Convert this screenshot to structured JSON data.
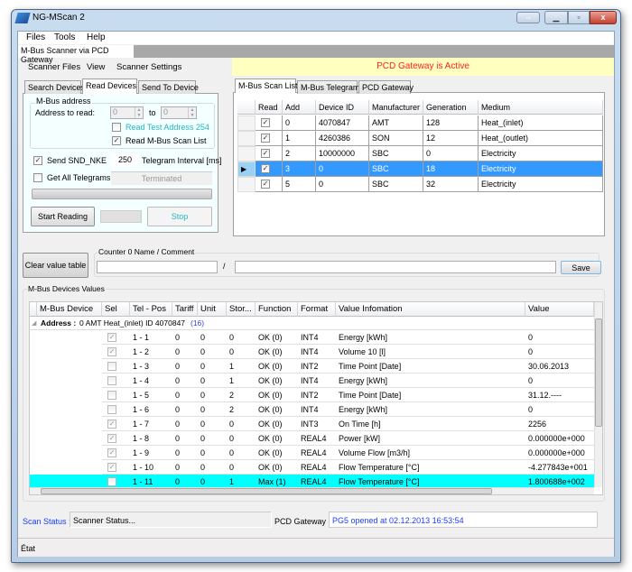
{
  "window": {
    "title": "NG-MScan 2",
    "controls": [
      "swap",
      "minimize",
      "maximize",
      "close"
    ]
  },
  "menu": [
    "Files",
    "Tools",
    "Help"
  ],
  "main_tab": "M-Bus Scanner via PCD Gateway",
  "inner_menu": [
    "Scanner Files",
    "View",
    "Scanner Settings"
  ],
  "banner": {
    "text": "PCD Gateway is Active",
    "color": "#ff2020",
    "bg": "#ffffc0"
  },
  "left_tabs": [
    "Search Devices",
    "Read Devices",
    "Send To Device"
  ],
  "read": {
    "group_title": "M-Bus address",
    "address_label": "Address to read:",
    "from": "0",
    "to_label": "to",
    "to": "0",
    "test_address": {
      "label": "Read Test Address 254",
      "checked": false
    },
    "scan_list": {
      "label": "Read M-Bus Scan List",
      "checked": true
    },
    "snd_nke": {
      "label": "Send SND_NKE",
      "checked": true
    },
    "interval": "250",
    "interval_label": "Telegram Interval [ms]",
    "all_telegrams": {
      "label": "Get All Telegrams",
      "checked": false
    },
    "status": "Terminated",
    "progress": 0,
    "start": "Start Reading",
    "stop": "Stop"
  },
  "right_tabs": [
    "M-Bus Scan List",
    "M-Bus Telegrams",
    "PCD Gateway"
  ],
  "scan_list": {
    "columns": [
      "Read",
      "Add",
      "Device ID",
      "Manufacturer",
      "Generation",
      "Medium"
    ],
    "rows": [
      {
        "read": true,
        "add": "0",
        "id": "4070847",
        "man": "AMT",
        "gen": "128",
        "medium": "Heat_(inlet)"
      },
      {
        "read": true,
        "add": "1",
        "id": "4260386",
        "man": "SON",
        "gen": "12",
        "medium": "Heat_(outlet)"
      },
      {
        "read": true,
        "add": "2",
        "id": "10000000",
        "man": "SBC",
        "gen": "0",
        "medium": "Electricity"
      },
      {
        "read": true,
        "add": "3",
        "id": "0",
        "man": "SBC",
        "gen": "18",
        "medium": "Electricity",
        "selected": true
      },
      {
        "read": true,
        "add": "5",
        "id": "0",
        "man": "SBC",
        "gen": "32",
        "medium": "Electricity"
      }
    ]
  },
  "clear_button": "Clear value table",
  "counter": {
    "title": "Counter 0 Name / Comment",
    "name": "",
    "separator": "/",
    "comment": "",
    "save": "Save"
  },
  "values": {
    "title": "M-Bus Devices Values",
    "columns": [
      "M-Bus Device",
      "Sel",
      "Tel - Pos",
      "Tariff",
      "Unit",
      "Stor...",
      "Function",
      "Format",
      "Value Infomation",
      "Value"
    ],
    "group": {
      "label": "Address :",
      "text": "0 AMT Heat_(inlet) ID 4070847",
      "count": "(16)"
    },
    "rows": [
      {
        "sel": true,
        "pos": "1 - 1",
        "tariff": "0",
        "unit": "0",
        "stor": "0",
        "func": "OK (0)",
        "fmt": "INT4",
        "info": "Energy [kWh]",
        "value": "0"
      },
      {
        "sel": true,
        "pos": "1 - 2",
        "tariff": "0",
        "unit": "0",
        "stor": "0",
        "func": "OK (0)",
        "fmt": "INT4",
        "info": "Volume 10 [l]",
        "value": "0"
      },
      {
        "sel": false,
        "pos": "1 - 3",
        "tariff": "0",
        "unit": "0",
        "stor": "1",
        "func": "OK (0)",
        "fmt": "INT2",
        "info": "Time Point [Date]",
        "value": "30.06.2013"
      },
      {
        "sel": false,
        "pos": "1 - 4",
        "tariff": "0",
        "unit": "0",
        "stor": "1",
        "func": "OK (0)",
        "fmt": "INT4",
        "info": "Energy [kWh]",
        "value": "0"
      },
      {
        "sel": false,
        "pos": "1 - 5",
        "tariff": "0",
        "unit": "0",
        "stor": "2",
        "func": "OK (0)",
        "fmt": "INT2",
        "info": "Time Point [Date]",
        "value": "31.12.----"
      },
      {
        "sel": false,
        "pos": "1 - 6",
        "tariff": "0",
        "unit": "0",
        "stor": "2",
        "func": "OK (0)",
        "fmt": "INT4",
        "info": "Energy [kWh]",
        "value": "0"
      },
      {
        "sel": true,
        "pos": "1 - 7",
        "tariff": "0",
        "unit": "0",
        "stor": "0",
        "func": "OK (0)",
        "fmt": "INT3",
        "info": "On Time [h]",
        "value": "2256"
      },
      {
        "sel": true,
        "pos": "1 - 8",
        "tariff": "0",
        "unit": "0",
        "stor": "0",
        "func": "OK (0)",
        "fmt": "REAL4",
        "info": "Power [kW]",
        "value": "0.000000e+000"
      },
      {
        "sel": true,
        "pos": "1 - 9",
        "tariff": "0",
        "unit": "0",
        "stor": "0",
        "func": "OK (0)",
        "fmt": "REAL4",
        "info": "Volume Flow [m3/h]",
        "value": "0.000000e+000"
      },
      {
        "sel": true,
        "pos": "1 - 10",
        "tariff": "0",
        "unit": "0",
        "stor": "0",
        "func": "OK (0)",
        "fmt": "REAL4",
        "info": "Flow Temperature [°C]",
        "value": "-4.277843e+001"
      },
      {
        "sel": false,
        "pos": "1 - 11",
        "tariff": "0",
        "unit": "0",
        "stor": "1",
        "func": "Max (1)",
        "fmt": "REAL4",
        "info": "Flow Temperature [°C]",
        "value": "1.800688e+002",
        "highlight": true
      }
    ]
  },
  "status": {
    "scan_label": "Scan Status :",
    "scan_value": "Scanner Status...",
    "gw_label": "PCD Gateway :",
    "gw_value": "PG5 opened at 02.12.2013 16:53:54"
  },
  "statusbar": "État",
  "colors": {
    "selection": "#3399ff",
    "highlight": "#00ffff",
    "link": "#1a3cff"
  }
}
